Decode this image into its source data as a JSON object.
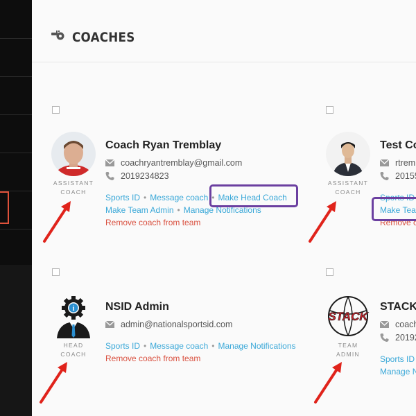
{
  "page": {
    "title": "COACHES"
  },
  "colors": {
    "link": "#3aa8d8",
    "remove": "#d9503f",
    "highlight_purple": "#6b3fa0",
    "annotation_red": "#e0231b"
  },
  "coaches": [
    {
      "name": "Coach Ryan Tremblay",
      "role": "ASSISTANT COACH",
      "email": "coachryantremblay@gmail.com",
      "phone": "2019234823",
      "actions": [
        "Sports ID",
        "Message coach",
        "Make Head Coach",
        "Make Team Admin",
        "Manage Notifications"
      ],
      "remove": "Remove coach from team"
    },
    {
      "name": "Test Co",
      "role": "ASSISTANT COACH",
      "email": "rtrem",
      "phone": "20155",
      "actions": [
        "Sports ID",
        "Make Team"
      ],
      "remove": "Remove c"
    },
    {
      "name": "NSID Admin",
      "role": "HEAD COACH",
      "email": "admin@nationalsportsid.com",
      "actions": [
        "Sports ID",
        "Message coach",
        "Manage Notifications"
      ],
      "remove": "Remove coach from team"
    },
    {
      "name": "STACK",
      "role": "TEAM ADMIN",
      "email": "coach",
      "phone": "20192",
      "actions": [
        "Sports ID",
        "Manage N"
      ],
      "logo_text": "STACK"
    }
  ]
}
